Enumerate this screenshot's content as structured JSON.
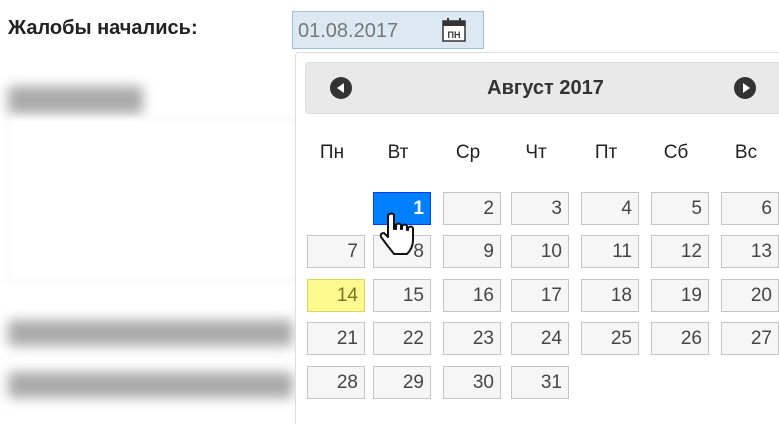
{
  "form": {
    "label": "Жалобы начались:",
    "date_value": "01.08.2017",
    "calendar_button_text": "ПН"
  },
  "datepicker": {
    "title": "Август 2017",
    "weekdays": [
      "Пн",
      "Вт",
      "Ср",
      "Чт",
      "Пт",
      "Сб",
      "Вс"
    ],
    "days": [
      "1",
      "2",
      "3",
      "4",
      "5",
      "6",
      "7",
      "8",
      "9",
      "10",
      "11",
      "12",
      "13",
      "14",
      "15",
      "16",
      "17",
      "18",
      "19",
      "20",
      "21",
      "22",
      "23",
      "24",
      "25",
      "26",
      "27",
      "28",
      "29",
      "30",
      "31"
    ],
    "selected_day": "1",
    "highlighted_day": "14"
  },
  "colors": {
    "selected": "#007fff",
    "highlight": "#fffa90",
    "header": "#e9e9e9"
  },
  "icons": {
    "prev": "circle-triangle-left-icon",
    "next": "circle-triangle-right-icon",
    "calendar": "calendar-icon",
    "cursor": "hand-pointer-icon"
  }
}
